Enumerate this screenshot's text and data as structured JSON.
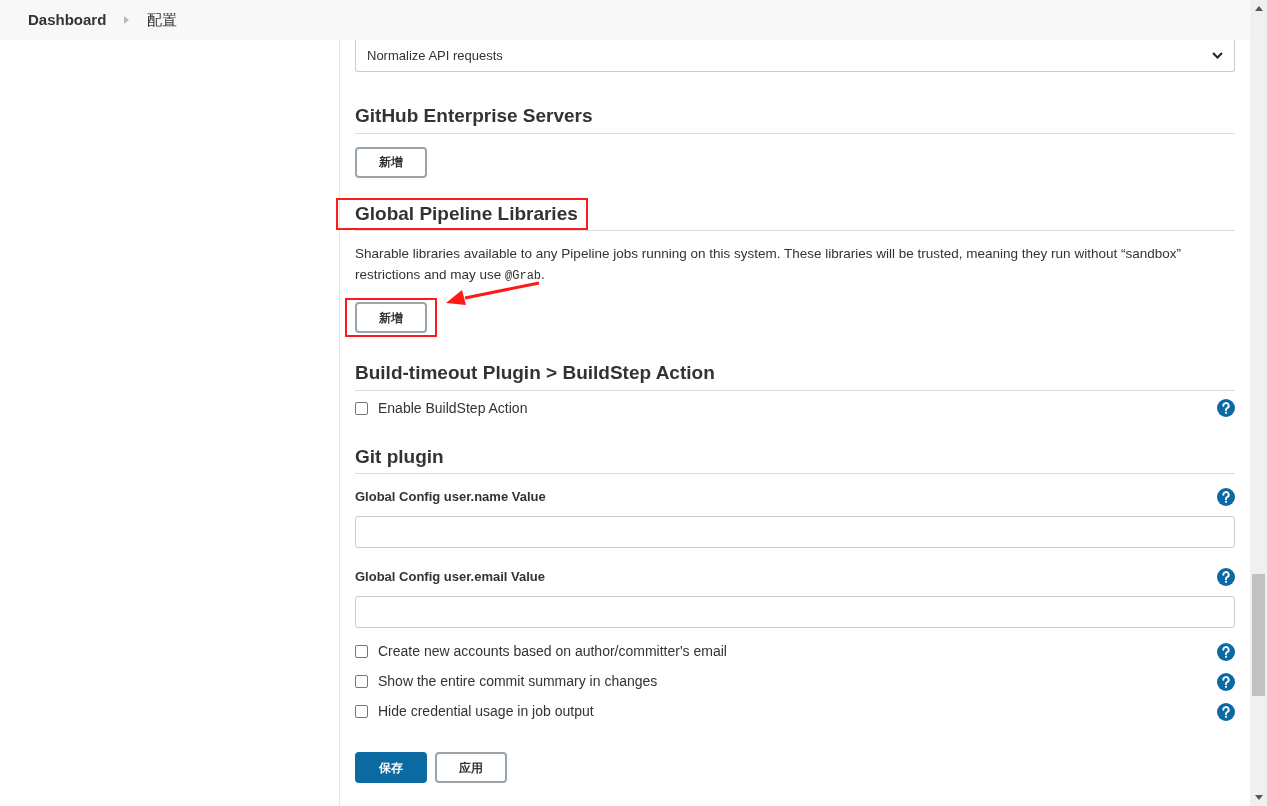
{
  "breadcrumb": [
    {
      "label": "Dashboard"
    },
    {
      "label": "配置"
    }
  ],
  "select": {
    "value": "Normalize API requests"
  },
  "sections": [
    {
      "title": "GitHub Enterprise Servers",
      "highlighted": false,
      "items": [
        {
          "kind": "button",
          "label": "新增",
          "highlighted": false
        }
      ]
    },
    {
      "title": "Global Pipeline Libraries",
      "highlighted": true,
      "items": [
        {
          "kind": "description",
          "text": "Sharable libraries available to any Pipeline jobs running on this system. These libraries will be trusted, meaning they run without “sandbox” restrictions and may use ",
          "code": "@Grab",
          "suffix": "."
        },
        {
          "kind": "button",
          "label": "新增",
          "highlighted": true
        }
      ]
    },
    {
      "title": "Build-timeout Plugin > BuildStep Action",
      "highlighted": false,
      "items": [
        {
          "kind": "checkbox",
          "label": "Enable BuildStep Action",
          "checked": false,
          "help": true
        }
      ]
    },
    {
      "title": "Git plugin",
      "highlighted": false,
      "items": [
        {
          "kind": "field",
          "label": "Global Config user.name Value",
          "help": true
        },
        {
          "kind": "field",
          "label": "Global Config user.email Value",
          "help": true
        },
        {
          "kind": "checkbox",
          "label": "Create new accounts based on author/committer's email",
          "checked": false,
          "help": true
        },
        {
          "kind": "checkbox",
          "label": "Show the entire commit summary in changes",
          "checked": false,
          "help": true
        },
        {
          "kind": "checkbox",
          "label": "Hide credential usage in job output",
          "checked": false,
          "help": true
        }
      ]
    }
  ],
  "annotation_arrow": true,
  "actions": [
    {
      "label": "保存",
      "primary": true
    },
    {
      "label": "应用",
      "primary": false
    }
  ]
}
